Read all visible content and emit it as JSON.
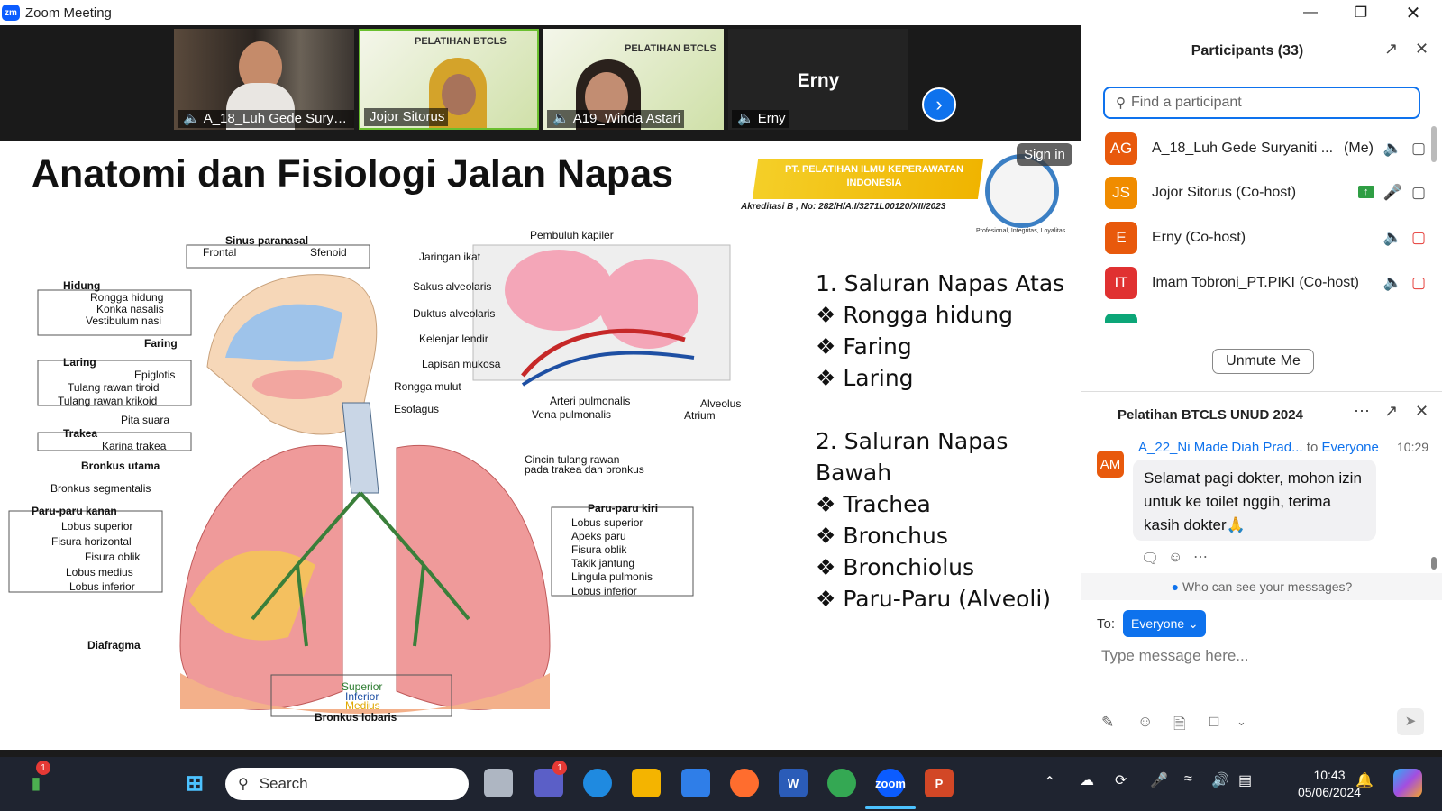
{
  "window": {
    "title": "Zoom Meeting",
    "logo": "zm"
  },
  "videos": [
    {
      "name": "A_18_Luh Gede Suryan...",
      "muted": true
    },
    {
      "name": "Jojor Sitorus",
      "muted": false
    },
    {
      "name": "A19_Winda Astari",
      "muted": true
    },
    {
      "name": "Erny",
      "muted": true,
      "big_name": "Erny"
    }
  ],
  "slide": {
    "title": "Anatomi dan Fisiologi Jalan Napas",
    "banner": "PT. PELATIHAN ILMU KEPERAWATAN INDONESIA",
    "accreditation": "Akreditasi B , No: 282/H/A.I/3271L00120/XII/2023",
    "motto": "Profesional, Integritas, Loyalitas",
    "sign_in": "Sign in",
    "outline": "1. Saluran Napas Atas\n❖ Rongga hidung\n❖ Faring\n❖ Laring\n\n2. Saluran Napas\nBawah\n❖ Trachea\n❖ Bronchus\n❖ Bronchiolus\n❖ Paru-Paru (Alveoli)",
    "diagram_labels": {
      "sinus": "Sinus paranasal",
      "frontal": "Frontal",
      "sfenoid": "Sfenoid",
      "hidung": "Hidung",
      "rongga_hidung": "Rongga hidung",
      "konka": "Konka nasalis",
      "vestibulum": "Vestibulum nasi",
      "faring": "Faring",
      "laring": "Laring",
      "epiglotis": "Epiglotis",
      "tiroid": "Tulang rawan tiroid",
      "krikoid": "Tulang rawan krikoid",
      "pita": "Pita suara",
      "trakea": "Trakea",
      "karina": "Karina trakea",
      "bronkus_utama": "Bronkus utama",
      "bronkus_seg": "Bronkus segmentalis",
      "paru_kanan": "Paru-paru kanan",
      "lobus_sup": "Lobus superior",
      "fisura_h": "Fisura horizontal",
      "fisura_o": "Fisura oblik",
      "lobus_med": "Lobus medius",
      "lobus_inf": "Lobus inferior",
      "diafragma": "Diafragma",
      "superior": "Superior",
      "inferior": "Inferior",
      "medius": "Medius",
      "bronkus_lob": "Bronkus lobaris",
      "pembuluh": "Pembuluh kapiler",
      "jaringan": "Jaringan ikat",
      "sakus": "Sakus alveolaris",
      "duktus": "Duktus alveolaris",
      "kelenjar": "Kelenjar lendir",
      "lapisan": "Lapisan mukosa",
      "rongga_mulut": "Rongga mulut",
      "esofagus": "Esofagus",
      "arteri": "Arteri pulmonalis",
      "vena": "Vena pulmonalis",
      "alveolus": "Alveolus",
      "atrium": "Atrium",
      "cincin": "Cincin tulang rawan",
      "cincin2": "pada trakea dan bronkus",
      "paru_kiri": "Paru-paru kiri",
      "lk_sup": "Lobus superior",
      "apeks": "Apeks paru",
      "lk_fisura": "Fisura oblik",
      "takik": "Takik jantung",
      "lingula": "Lingula pulmonis",
      "lk_inf": "Lobus inferior"
    }
  },
  "participants": {
    "header": "Participants (33)",
    "search_placeholder": "Find a participant",
    "list": [
      {
        "initials": "AG",
        "name": "A_18_Luh Gede Suryaniti ...",
        "suffix": "(Me)",
        "color": "#e8590c"
      },
      {
        "initials": "JS",
        "name": "Jojor Sitorus (Co-host)",
        "suffix": "",
        "color": "#f08c00"
      },
      {
        "initials": "E",
        "name": "Erny (Co-host)",
        "suffix": "",
        "color": "#e8590c"
      },
      {
        "initials": "IT",
        "name": "Imam Tobroni_PT.PIKI (Co-host)",
        "suffix": "",
        "color": "#e03131"
      }
    ],
    "unmute_label": "Unmute Me"
  },
  "chat": {
    "title": "Pelatihan BTCLS UNUD 2024",
    "sender": "A_22_Ni Made Diah Prad...",
    "to_word": "to",
    "recipient": "Everyone",
    "time": "10:29",
    "avatar": "AM",
    "message": "Selamat pagi dokter, mohon izin untuk ke toilet nggih, terima kasih dokter🙏",
    "visibility_link": "Who can see your messages?",
    "to_label": "To:",
    "to_value": "Everyone",
    "input_placeholder": "Type message here..."
  },
  "taskbar": {
    "search_label": "Search",
    "time": "10:43",
    "date": "05/06/2024",
    "badge_chart": "1",
    "badge_teams": "1"
  }
}
